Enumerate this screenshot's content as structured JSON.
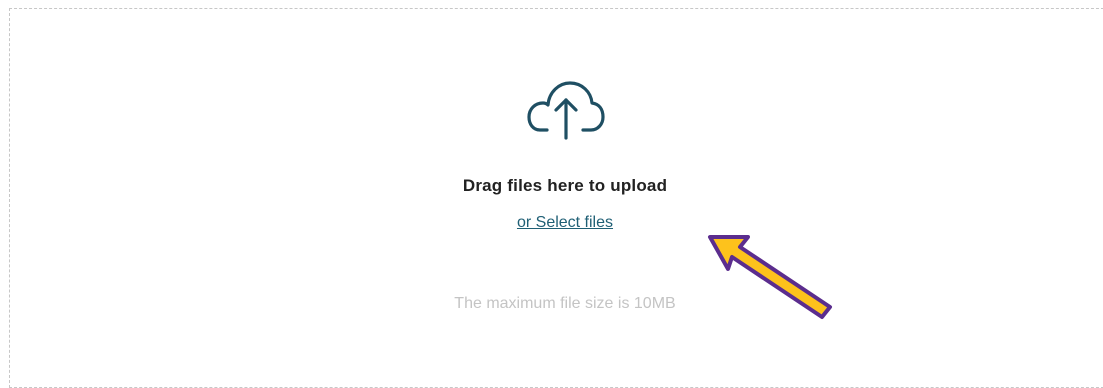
{
  "upload": {
    "title": "Drag files here to upload",
    "select_link": "or Select files",
    "max_size_text": "The maximum file size is 10MB",
    "icon": "cloud-upload-icon"
  },
  "annotation": {
    "arrow_icon": "pointer-arrow-icon",
    "arrow_fill": "#FDC21C",
    "arrow_stroke": "#5B2D8E"
  },
  "colors": {
    "link": "#1F5F75",
    "icon": "#1F4F63",
    "muted_text": "#C4C4C4",
    "title_text": "#222222"
  }
}
